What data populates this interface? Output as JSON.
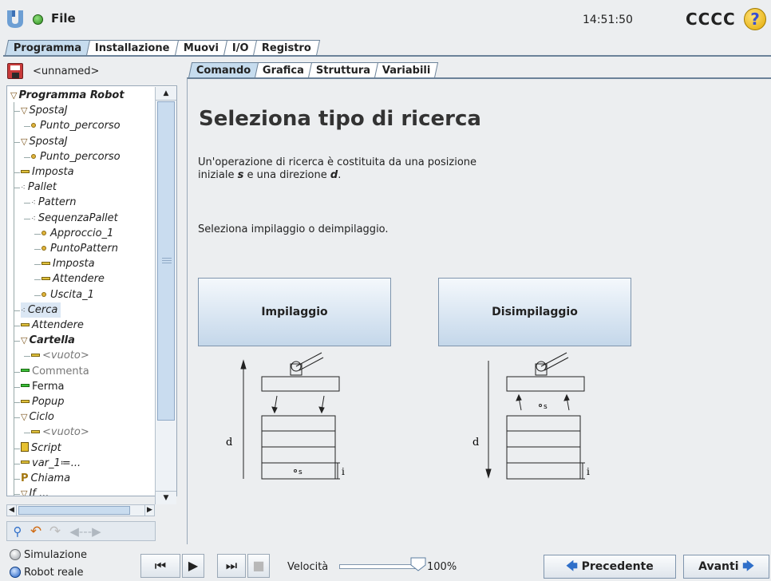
{
  "titlebar": {
    "file_label": "File",
    "clock": "14:51:50",
    "robot_name": "CCCC",
    "help_label": "?"
  },
  "main_tabs": [
    "Programma",
    "Installazione",
    "Muovi",
    "I/O",
    "Registro"
  ],
  "program": {
    "name": "<unnamed>"
  },
  "tree": [
    {
      "label": "Programma Robot",
      "style": "bold italic",
      "icon": "triangle-down"
    },
    {
      "label": "SpostaJ",
      "style": "italic",
      "icon": "triangle-down"
    },
    {
      "label": "Punto_percorso",
      "style": "italic",
      "icon": "waypoint"
    },
    {
      "label": "SpostaJ",
      "style": "italic",
      "icon": "triangle-down"
    },
    {
      "label": "Punto_percorso",
      "style": "italic",
      "icon": "waypoint"
    },
    {
      "label": "Imposta",
      "style": "italic",
      "icon": "set"
    },
    {
      "label": "Pallet",
      "style": "italic",
      "icon": "pallet"
    },
    {
      "label": "Pattern",
      "style": "italic",
      "icon": "pallet"
    },
    {
      "label": "SequenzaPallet",
      "style": "italic",
      "icon": "pallet"
    },
    {
      "label": "Approccio_1",
      "style": "italic",
      "icon": "waypoint"
    },
    {
      "label": "PuntoPattern",
      "style": "italic",
      "icon": "waypoint"
    },
    {
      "label": "Imposta",
      "style": "italic",
      "icon": "set"
    },
    {
      "label": "Attendere",
      "style": "italic",
      "icon": "set"
    },
    {
      "label": "Uscita_1",
      "style": "italic",
      "icon": "waypoint"
    },
    {
      "label": "Cerca",
      "style": "italic",
      "icon": "pallet"
    },
    {
      "label": "Attendere",
      "style": "italic",
      "icon": "set"
    },
    {
      "label": "Cartella",
      "style": "bold italic",
      "icon": "triangle-down"
    },
    {
      "label": "<vuoto>",
      "style": "italic gray",
      "icon": "set"
    },
    {
      "label": "Commenta",
      "style": "gray",
      "icon": "comment"
    },
    {
      "label": "Ferma",
      "style": "",
      "icon": "stop"
    },
    {
      "label": "Popup",
      "style": "italic",
      "icon": "set"
    },
    {
      "label": "Ciclo",
      "style": "italic",
      "icon": "triangle-down"
    },
    {
      "label": "<vuoto>",
      "style": "italic gray",
      "icon": "set"
    },
    {
      "label": "Script",
      "style": "italic",
      "icon": "script"
    },
    {
      "label": "var_1≔...",
      "style": "italic",
      "icon": "set"
    },
    {
      "label": "Chiama",
      "style": "italic",
      "icon": "call"
    },
    {
      "label": "If ...",
      "style": "italic",
      "icon": "triangle-down"
    }
  ],
  "tree_selected_index": 14,
  "sub_tabs": [
    "Comando",
    "Grafica",
    "Struttura",
    "Variabili"
  ],
  "content": {
    "title": "Seleziona tipo di ricerca",
    "intro_part1": "Un'operazione di ricerca è costituita da una posizione iniziale ",
    "intro_s": "s",
    "intro_part2": " e una direzione ",
    "intro_d": "d",
    "intro_part3": ".",
    "select_prompt": "Seleziona impilaggio o deimpilaggio.",
    "stack_button": "Impilaggio",
    "unstack_button": "Disimpilaggio",
    "diagram_d": "d",
    "diagram_i": "i",
    "diagram_s": "s"
  },
  "footer": {
    "sim_label": "Simulazione",
    "real_label": "Robot reale",
    "speed_label": "Velocità",
    "speed_value": "100%",
    "speed_fraction": 1.0,
    "prev_label": "Precedente",
    "next_label": "Avanti"
  },
  "colors": {
    "accent_tab": "#c6dcee",
    "button_gradient_bottom": "#c4d7ea",
    "frame": "#6b8299"
  }
}
